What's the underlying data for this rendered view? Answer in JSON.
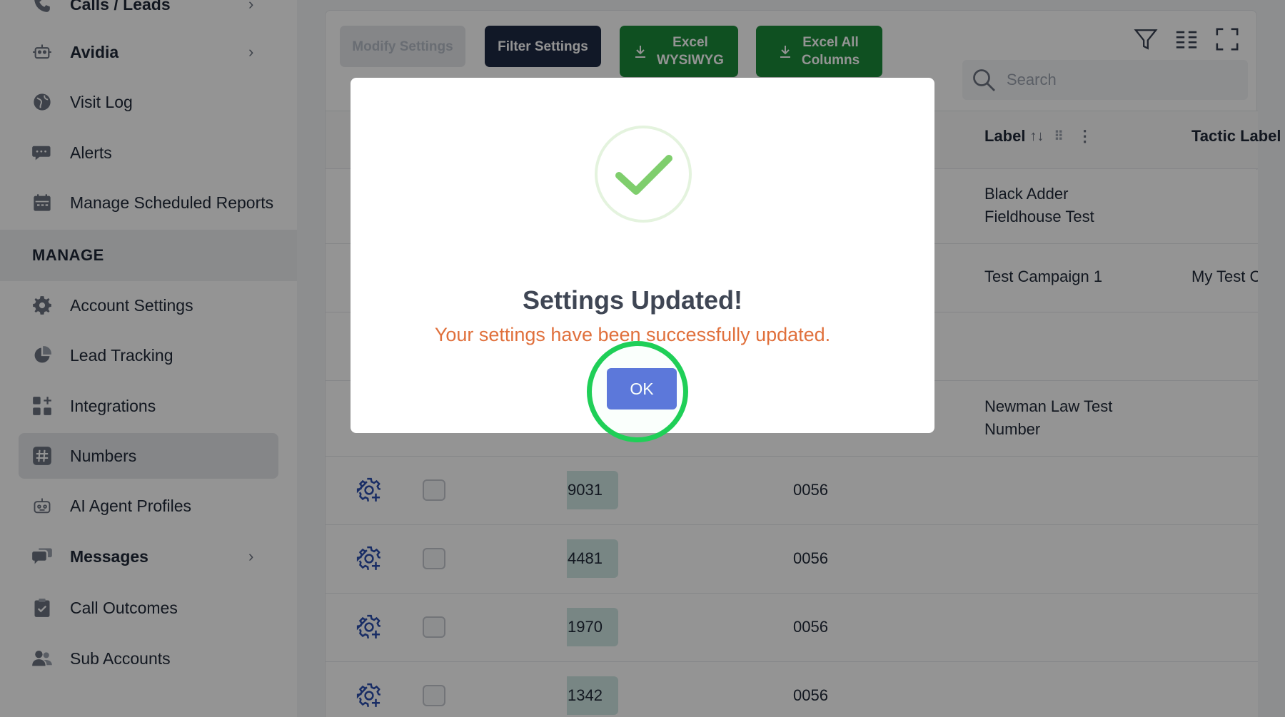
{
  "sidebar": {
    "items_top": [
      {
        "label": "Calls / Leads",
        "icon": "phone-icon",
        "has_chevron": true
      },
      {
        "label": "Avidia",
        "icon": "robot-icon",
        "has_chevron": true
      },
      {
        "label": "Visit Log",
        "icon": "globe-icon",
        "has_chevron": false
      },
      {
        "label": "Alerts",
        "icon": "chat-bubble-icon",
        "has_chevron": false
      },
      {
        "label": "Manage Scheduled Reports",
        "icon": "calendar-icon",
        "has_chevron": false
      }
    ],
    "section_label": "MANAGE",
    "items_manage": [
      {
        "label": "Account Settings",
        "icon": "gear-icon"
      },
      {
        "label": "Lead Tracking",
        "icon": "pie-chart-icon"
      },
      {
        "label": "Integrations",
        "icon": "grid-plus-icon"
      },
      {
        "label": "Numbers",
        "icon": "hash-icon",
        "active": true
      },
      {
        "label": "AI Agent Profiles",
        "icon": "robot-face-icon"
      },
      {
        "label": "Messages",
        "icon": "chat-bubbles-icon",
        "has_chevron": true
      },
      {
        "label": "Call Outcomes",
        "icon": "clipboard-check-icon"
      },
      {
        "label": "Sub Accounts",
        "icon": "users-icon"
      }
    ]
  },
  "toolbar": {
    "modify_label": "Modify Settings",
    "filter_label": "Filter Settings",
    "excel_wysiwyg_line1": "Excel",
    "excel_wysiwyg_line2": "WYSIWYG",
    "excel_all_line1": "Excel All",
    "excel_all_line2": "Columns",
    "icons": [
      "filter-icon",
      "columns-icon",
      "fullscreen-icon"
    ]
  },
  "search": {
    "placeholder": "Search"
  },
  "table": {
    "headers": {
      "label": "Label",
      "tactic_label": "Tactic Label"
    },
    "rows": [
      {
        "label_line1": "Black Adder",
        "label_line2": "Fieldhouse Test",
        "tactic": ""
      },
      {
        "label_line1": "Test Campaign 1",
        "label_line2": "",
        "tactic": "My Test Camp"
      },
      {
        "label_line1": "",
        "label_line2": "",
        "tactic": ""
      },
      {
        "label_line1": "Newman Law Test",
        "label_line2": "Number",
        "tactic": ""
      },
      {
        "number_suffix": "9031",
        "alt_suffix": "0056"
      },
      {
        "number_suffix": "4481",
        "alt_suffix": "0056"
      },
      {
        "number_suffix": "1970",
        "alt_suffix": "0056"
      },
      {
        "number_suffix": "1342",
        "alt_suffix": "0056"
      }
    ]
  },
  "modal": {
    "title": "Settings Updated!",
    "message": "Your settings have been successfully updated.",
    "ok_label": "OK"
  },
  "colors": {
    "accent_blue": "#3f5bd6",
    "excel_green": "#1a8a3a",
    "filter_navy": "#1e2a44",
    "success_green": "#7fce6d",
    "message_orange": "#e0703c",
    "highlight_ring": "#1fcf57"
  }
}
